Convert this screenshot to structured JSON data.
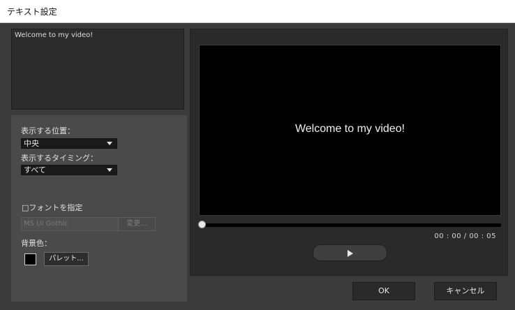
{
  "window": {
    "title": "テキスト設定"
  },
  "text_area": {
    "value": "Welcome to my video!"
  },
  "settings": {
    "position_label": "表示する位置：",
    "position_value": "中央",
    "timing_label": "表示するタイミング：",
    "timing_value": "すべて",
    "font_checkbox_label": "□フォントを指定",
    "font_name": "MS UI Gothic",
    "change_button": "変更...",
    "bg_color_label": "背景色：",
    "palette_button": "パレット..."
  },
  "preview": {
    "video_text": "Welcome to my video!",
    "time_display": "00 : 00 / 00 : 05",
    "progress": 0.0
  },
  "footer": {
    "ok": "OK",
    "cancel": "キャンセル"
  },
  "colors": {
    "background_color_swatch": "#000000"
  }
}
